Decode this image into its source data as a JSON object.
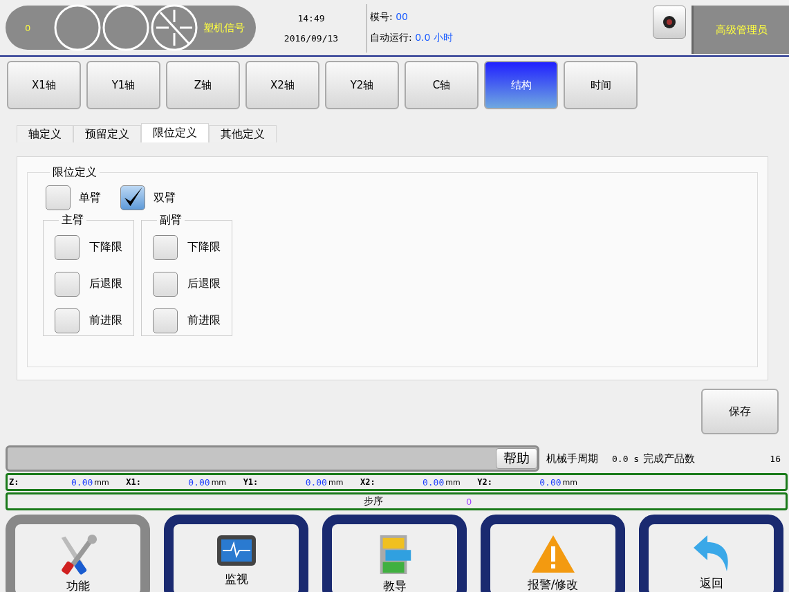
{
  "header": {
    "counter": "0",
    "signal_label": "塑机信号",
    "time": "14:49",
    "date": "2016/09/13",
    "mold_label": "模号:",
    "mold_value": "00",
    "run_label": "自动运行:",
    "run_value": "0.0 小时",
    "user": "高级管理员"
  },
  "nav_tabs": [
    {
      "label": "X1轴",
      "selected": false
    },
    {
      "label": "Y1轴",
      "selected": false
    },
    {
      "label": "Z轴",
      "selected": false
    },
    {
      "label": "X2轴",
      "selected": false
    },
    {
      "label": "Y2轴",
      "selected": false
    },
    {
      "label": "C轴",
      "selected": false
    },
    {
      "label": "结构",
      "selected": true
    },
    {
      "label": "时间",
      "selected": false
    }
  ],
  "sub_tabs": [
    {
      "label": "轴定义",
      "selected": false
    },
    {
      "label": "预留定义",
      "selected": false
    },
    {
      "label": "限位定义",
      "selected": true
    },
    {
      "label": "其他定义",
      "selected": false
    }
  ],
  "group": {
    "title": "限位定义",
    "arm_options": [
      {
        "label": "单臂",
        "checked": false
      },
      {
        "label": "双臂",
        "checked": true
      }
    ],
    "panels": [
      {
        "title": "主臂",
        "items": [
          {
            "label": "下降限",
            "checked": false
          },
          {
            "label": "后退限",
            "checked": false
          },
          {
            "label": "前进限",
            "checked": false
          }
        ]
      },
      {
        "title": "副臂",
        "items": [
          {
            "label": "下降限",
            "checked": false
          },
          {
            "label": "后退限",
            "checked": false
          },
          {
            "label": "前进限",
            "checked": false
          }
        ]
      }
    ]
  },
  "save_button": "保存",
  "status": {
    "help_button": "帮助",
    "cycle_label": "机械手周期",
    "cycle_value": "0.0 s",
    "count_label": "完成产品数",
    "count_value": "16"
  },
  "axes": [
    {
      "name": "Z:",
      "value": "0.00",
      "unit": "mm"
    },
    {
      "name": "X1:",
      "value": "0.00",
      "unit": "mm"
    },
    {
      "name": "Y1:",
      "value": "0.00",
      "unit": "mm"
    },
    {
      "name": "X2:",
      "value": "0.00",
      "unit": "mm"
    },
    {
      "name": "Y2:",
      "value": "0.00",
      "unit": "mm"
    }
  ],
  "step": {
    "label": "步序",
    "value": "0"
  },
  "bottom_nav": [
    {
      "label": "功能",
      "kind": "tools",
      "selected": true
    },
    {
      "label": "监视",
      "kind": "monitor",
      "selected": false
    },
    {
      "label": "教导",
      "kind": "cabinet",
      "selected": false
    },
    {
      "label": "报警/修改",
      "kind": "warning",
      "selected": false
    },
    {
      "label": "返回",
      "kind": "back",
      "selected": false
    }
  ]
}
